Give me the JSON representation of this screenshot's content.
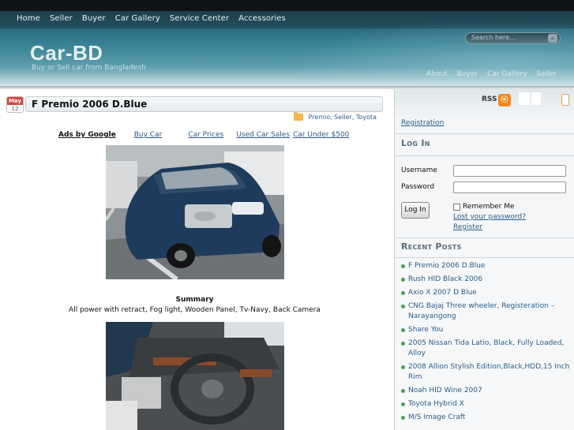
{
  "header": {
    "nav": [
      "Home",
      "Seller",
      "Buyer",
      "Car Gallery",
      "Service Center",
      "Accessories"
    ],
    "search_placeholder": "Search here...",
    "logo": "Car-BD",
    "tagline": "Buy or Sell car from Bangladesh",
    "subnav": [
      "About",
      "Buyer",
      "Car Gallery",
      "Seller"
    ]
  },
  "post": {
    "date_month": "May",
    "date_day": "12",
    "title": "F Premio 2006 D.Blue",
    "categories": "Premio, Seller, Toyota",
    "ads_label": "Ads by Google",
    "ad_links": [
      "Buy Car",
      "Car Prices",
      "Used Car Sales",
      "Car Under $500"
    ],
    "summary_heading": "Summary",
    "summary_text": "All power with retract, Fog light, Wooden Panel, Tv-Navy, Back Camera"
  },
  "sidebar": {
    "rss_label": "RSS",
    "registration_link": "Registration",
    "login_heading": "Log In",
    "username_label": "Username",
    "password_label": "Password",
    "remember_label": "Remember Me",
    "lost_password": "Lost your password?",
    "register_link": "Register",
    "login_button": "Log In",
    "recent_heading": "Recent Posts",
    "recent_posts": [
      "F Premio 2006 D.Blue",
      "Rush HID Black 2006",
      "Axio X 2007 D Blue",
      "CNG Bajaj Three wheeler, Registeration – Narayangong",
      "Share You",
      "2005 Nissan Tida Latio, Black, Fully Loaded, Alloy",
      "2008 Allion Stylish Edition,Black,HDD,15 Inch Rim",
      "Noah HID Wine 2007",
      "Toyota Hybrid X",
      "M/S Image Craft"
    ]
  },
  "colors": {
    "link": "#2a5d88",
    "header_dark": "#1e4a5c",
    "bullet": "#4aa05a",
    "rss": "#f68a1f"
  }
}
